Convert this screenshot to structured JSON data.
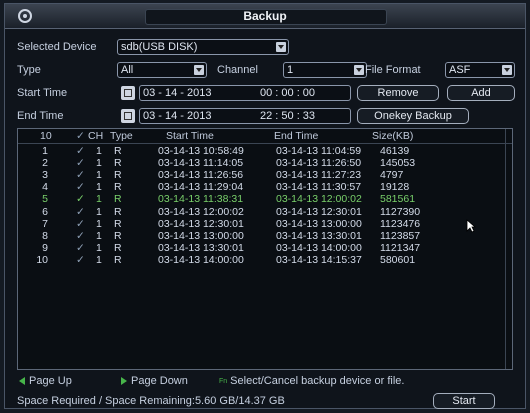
{
  "window": {
    "title": "Backup"
  },
  "form": {
    "selected_device_label": "Selected Device",
    "selected_device_value": "sdb(USB DISK)",
    "type_label": "Type",
    "type_value": "All",
    "channel_label": "Channel",
    "channel_value": "1",
    "file_format_label": "File Format",
    "file_format_value": "ASF",
    "start_time_label": "Start Time",
    "start_date": "03 - 14 - 2013",
    "start_clock": "00 : 00 : 00",
    "end_time_label": "End Time",
    "end_date": "03 - 14 - 2013",
    "end_clock": "22 : 50 : 33",
    "remove_button": "Remove",
    "add_button": "Add",
    "onekey_button": "Onekey Backup"
  },
  "table": {
    "headers": {
      "count": "10",
      "ch": "CH",
      "type": "Type",
      "start": "Start Time",
      "end": "End Time",
      "size": "Size(KB)"
    },
    "rows": [
      {
        "no": "1",
        "ch": "1",
        "type": "R",
        "start": "03-14-13 10:58:49",
        "end": "03-14-13 11:04:59",
        "size": "46139"
      },
      {
        "no": "2",
        "ch": "1",
        "type": "R",
        "start": "03-14-13 11:14:05",
        "end": "03-14-13 11:26:50",
        "size": "145053"
      },
      {
        "no": "3",
        "ch": "1",
        "type": "R",
        "start": "03-14-13 11:26:56",
        "end": "03-14-13 11:27:23",
        "size": "4797"
      },
      {
        "no": "4",
        "ch": "1",
        "type": "R",
        "start": "03-14-13 11:29:04",
        "end": "03-14-13 11:30:57",
        "size": "19128"
      },
      {
        "no": "5",
        "ch": "1",
        "type": "R",
        "start": "03-14-13 11:38:31",
        "end": "03-14-13 12:00:02",
        "size": "581561"
      },
      {
        "no": "6",
        "ch": "1",
        "type": "R",
        "start": "03-14-13 12:00:02",
        "end": "03-14-13 12:30:01",
        "size": "1127390"
      },
      {
        "no": "7",
        "ch": "1",
        "type": "R",
        "start": "03-14-13 12:30:01",
        "end": "03-14-13 13:00:00",
        "size": "1123476"
      },
      {
        "no": "8",
        "ch": "1",
        "type": "R",
        "start": "03-14-13 13:00:00",
        "end": "03-14-13 13:30:01",
        "size": "1123857"
      },
      {
        "no": "9",
        "ch": "1",
        "type": "R",
        "start": "03-14-13 13:30:01",
        "end": "03-14-13 14:00:00",
        "size": "1121347"
      },
      {
        "no": "10",
        "ch": "1",
        "type": "R",
        "start": "03-14-13 14:00:00",
        "end": "03-14-13 14:15:37",
        "size": "580601"
      }
    ],
    "highlighted_row": "5",
    "highlight_color": "#79d06a"
  },
  "footer": {
    "page_up": "Page Up",
    "page_down": "Page Down",
    "hint": "Select/Cancel backup device or file.",
    "fn_key": "Fn",
    "space_text": "Space Required / Space Remaining:5.60 GB/14.37 GB",
    "start_button": "Start"
  }
}
